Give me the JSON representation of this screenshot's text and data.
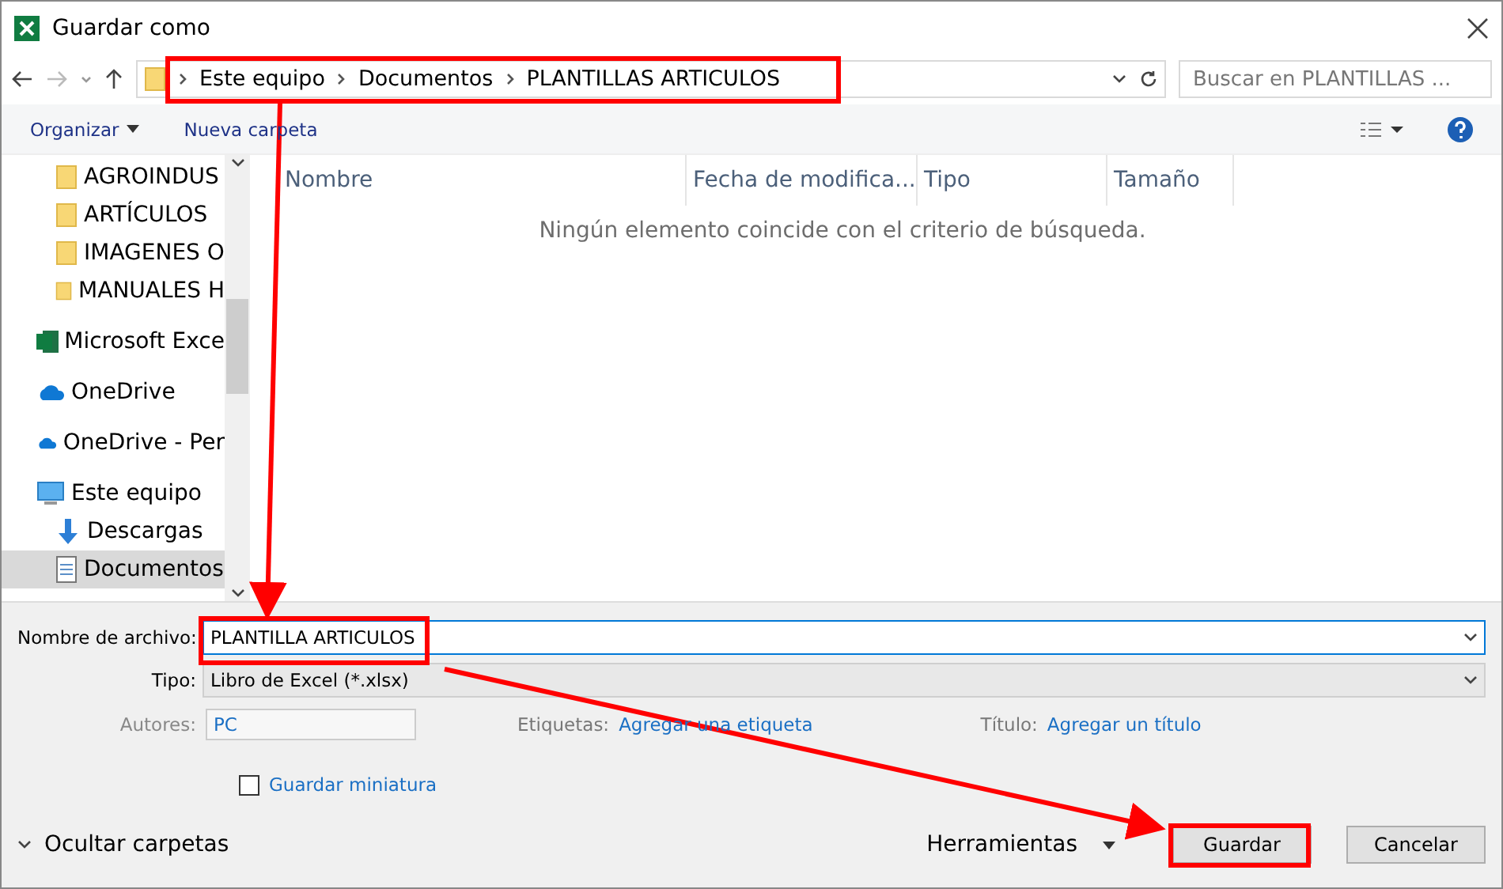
{
  "window": {
    "title": "Guardar como"
  },
  "address": {
    "crumbs": [
      "Este equipo",
      "Documentos",
      "PLANTILLAS ARTICULOS"
    ],
    "search_placeholder": "Buscar en PLANTILLAS ..."
  },
  "toolbar": {
    "organize": "Organizar",
    "new_folder": "Nueva carpeta"
  },
  "sidebar": {
    "items": [
      {
        "kind": "folder",
        "label": "AGROINDUS",
        "selected": false
      },
      {
        "kind": "folder",
        "label": "ARTÍCULOS",
        "selected": false
      },
      {
        "kind": "folder",
        "label": "IMAGENES O",
        "selected": false
      },
      {
        "kind": "folder",
        "label": "MANUALES H",
        "selected": false
      },
      {
        "kind": "excel",
        "label": "Microsoft Exce",
        "selected": false
      },
      {
        "kind": "cloud",
        "label": "OneDrive",
        "selected": false
      },
      {
        "kind": "cloud",
        "label": "OneDrive - Per",
        "selected": false
      },
      {
        "kind": "pc",
        "label": "Este equipo",
        "selected": false,
        "children": [
          {
            "kind": "download",
            "label": "Descargas",
            "selected": false
          },
          {
            "kind": "document",
            "label": "Documentos",
            "selected": true
          }
        ]
      }
    ]
  },
  "table": {
    "columns": [
      "Nombre",
      "Fecha de modifica...",
      "Tipo",
      "Tamaño"
    ],
    "empty_message": "Ningún elemento coincide con el criterio de búsqueda."
  },
  "form": {
    "filename_label": "Nombre de archivo:",
    "filename": "PLANTILLA ARTICULOS",
    "type_label": "Tipo:",
    "type": "Libro de Excel (*.xlsx)",
    "authors_label": "Autores:",
    "authors": "PC",
    "tags_label": "Etiquetas:",
    "tags_link": "Agregar una etiqueta",
    "title_label": "Título:",
    "title_link": "Agregar un título",
    "thumbnail_label": "Guardar miniatura",
    "thumbnail_checked": false
  },
  "footer": {
    "hide_folders": "Ocultar carpetas",
    "tools": "Herramientas",
    "save": "Guardar",
    "cancel": "Cancelar"
  }
}
